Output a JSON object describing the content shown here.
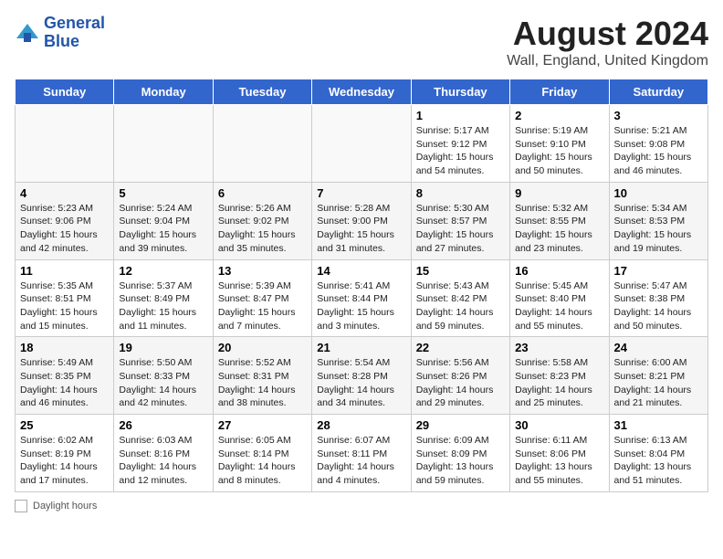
{
  "header": {
    "logo_line1": "General",
    "logo_line2": "Blue",
    "month_year": "August 2024",
    "location": "Wall, England, United Kingdom"
  },
  "days_of_week": [
    "Sunday",
    "Monday",
    "Tuesday",
    "Wednesday",
    "Thursday",
    "Friday",
    "Saturday"
  ],
  "weeks": [
    [
      {
        "day": "",
        "info": ""
      },
      {
        "day": "",
        "info": ""
      },
      {
        "day": "",
        "info": ""
      },
      {
        "day": "",
        "info": ""
      },
      {
        "day": "1",
        "info": "Sunrise: 5:17 AM\nSunset: 9:12 PM\nDaylight: 15 hours and 54 minutes."
      },
      {
        "day": "2",
        "info": "Sunrise: 5:19 AM\nSunset: 9:10 PM\nDaylight: 15 hours and 50 minutes."
      },
      {
        "day": "3",
        "info": "Sunrise: 5:21 AM\nSunset: 9:08 PM\nDaylight: 15 hours and 46 minutes."
      }
    ],
    [
      {
        "day": "4",
        "info": "Sunrise: 5:23 AM\nSunset: 9:06 PM\nDaylight: 15 hours and 42 minutes."
      },
      {
        "day": "5",
        "info": "Sunrise: 5:24 AM\nSunset: 9:04 PM\nDaylight: 15 hours and 39 minutes."
      },
      {
        "day": "6",
        "info": "Sunrise: 5:26 AM\nSunset: 9:02 PM\nDaylight: 15 hours and 35 minutes."
      },
      {
        "day": "7",
        "info": "Sunrise: 5:28 AM\nSunset: 9:00 PM\nDaylight: 15 hours and 31 minutes."
      },
      {
        "day": "8",
        "info": "Sunrise: 5:30 AM\nSunset: 8:57 PM\nDaylight: 15 hours and 27 minutes."
      },
      {
        "day": "9",
        "info": "Sunrise: 5:32 AM\nSunset: 8:55 PM\nDaylight: 15 hours and 23 minutes."
      },
      {
        "day": "10",
        "info": "Sunrise: 5:34 AM\nSunset: 8:53 PM\nDaylight: 15 hours and 19 minutes."
      }
    ],
    [
      {
        "day": "11",
        "info": "Sunrise: 5:35 AM\nSunset: 8:51 PM\nDaylight: 15 hours and 15 minutes."
      },
      {
        "day": "12",
        "info": "Sunrise: 5:37 AM\nSunset: 8:49 PM\nDaylight: 15 hours and 11 minutes."
      },
      {
        "day": "13",
        "info": "Sunrise: 5:39 AM\nSunset: 8:47 PM\nDaylight: 15 hours and 7 minutes."
      },
      {
        "day": "14",
        "info": "Sunrise: 5:41 AM\nSunset: 8:44 PM\nDaylight: 15 hours and 3 minutes."
      },
      {
        "day": "15",
        "info": "Sunrise: 5:43 AM\nSunset: 8:42 PM\nDaylight: 14 hours and 59 minutes."
      },
      {
        "day": "16",
        "info": "Sunrise: 5:45 AM\nSunset: 8:40 PM\nDaylight: 14 hours and 55 minutes."
      },
      {
        "day": "17",
        "info": "Sunrise: 5:47 AM\nSunset: 8:38 PM\nDaylight: 14 hours and 50 minutes."
      }
    ],
    [
      {
        "day": "18",
        "info": "Sunrise: 5:49 AM\nSunset: 8:35 PM\nDaylight: 14 hours and 46 minutes."
      },
      {
        "day": "19",
        "info": "Sunrise: 5:50 AM\nSunset: 8:33 PM\nDaylight: 14 hours and 42 minutes."
      },
      {
        "day": "20",
        "info": "Sunrise: 5:52 AM\nSunset: 8:31 PM\nDaylight: 14 hours and 38 minutes."
      },
      {
        "day": "21",
        "info": "Sunrise: 5:54 AM\nSunset: 8:28 PM\nDaylight: 14 hours and 34 minutes."
      },
      {
        "day": "22",
        "info": "Sunrise: 5:56 AM\nSunset: 8:26 PM\nDaylight: 14 hours and 29 minutes."
      },
      {
        "day": "23",
        "info": "Sunrise: 5:58 AM\nSunset: 8:23 PM\nDaylight: 14 hours and 25 minutes."
      },
      {
        "day": "24",
        "info": "Sunrise: 6:00 AM\nSunset: 8:21 PM\nDaylight: 14 hours and 21 minutes."
      }
    ],
    [
      {
        "day": "25",
        "info": "Sunrise: 6:02 AM\nSunset: 8:19 PM\nDaylight: 14 hours and 17 minutes."
      },
      {
        "day": "26",
        "info": "Sunrise: 6:03 AM\nSunset: 8:16 PM\nDaylight: 14 hours and 12 minutes."
      },
      {
        "day": "27",
        "info": "Sunrise: 6:05 AM\nSunset: 8:14 PM\nDaylight: 14 hours and 8 minutes."
      },
      {
        "day": "28",
        "info": "Sunrise: 6:07 AM\nSunset: 8:11 PM\nDaylight: 14 hours and 4 minutes."
      },
      {
        "day": "29",
        "info": "Sunrise: 6:09 AM\nSunset: 8:09 PM\nDaylight: 13 hours and 59 minutes."
      },
      {
        "day": "30",
        "info": "Sunrise: 6:11 AM\nSunset: 8:06 PM\nDaylight: 13 hours and 55 minutes."
      },
      {
        "day": "31",
        "info": "Sunrise: 6:13 AM\nSunset: 8:04 PM\nDaylight: 13 hours and 51 minutes."
      }
    ]
  ],
  "footer": {
    "label": "Daylight hours"
  }
}
